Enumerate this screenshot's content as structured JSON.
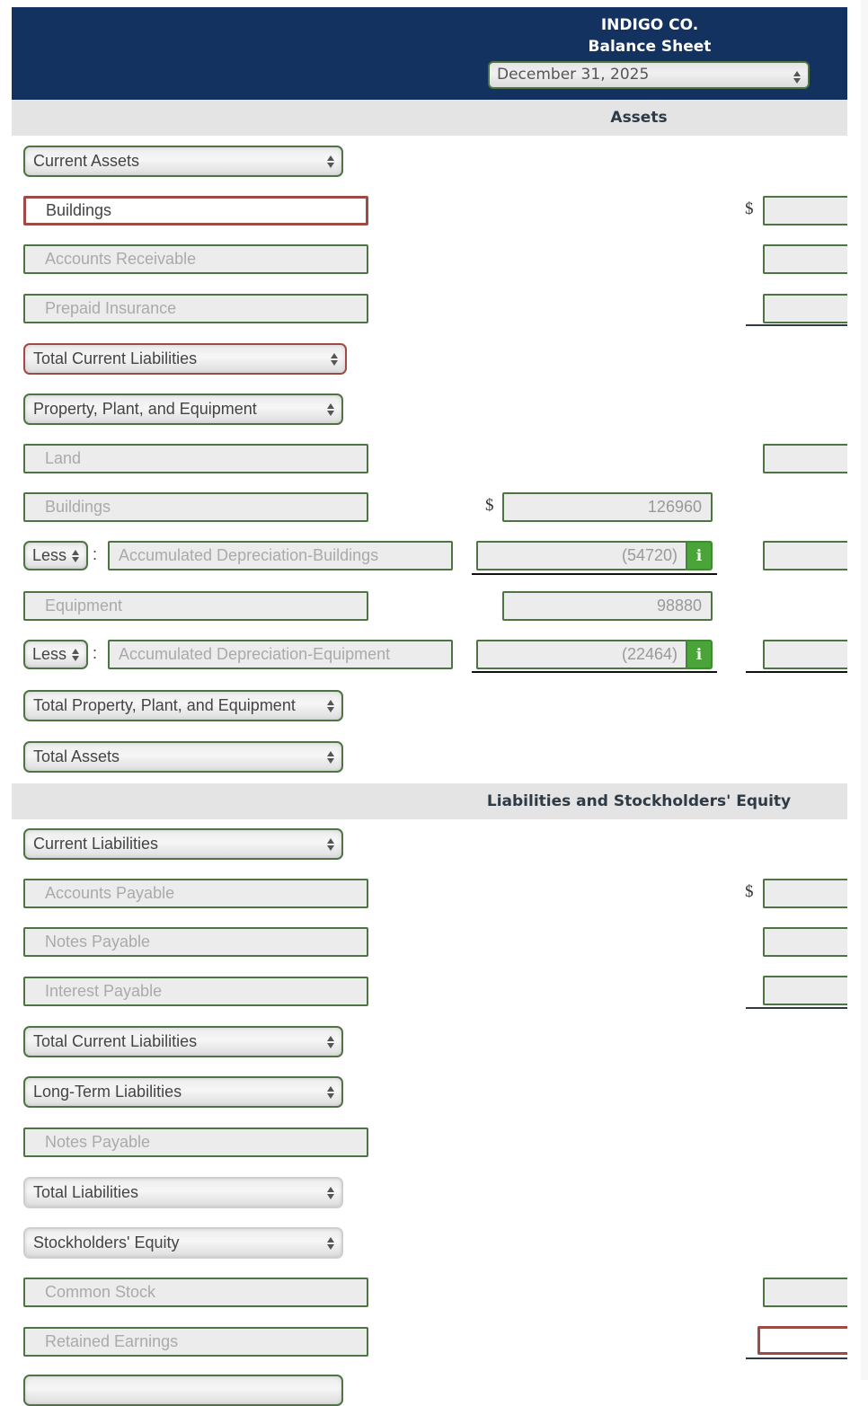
{
  "header": {
    "company": "INDIGO CO.",
    "statement": "Balance Sheet",
    "date_select": "December 31, 2025"
  },
  "sections": {
    "assets": "Assets",
    "liabilities_equity": "Liabilities and Stockholders' Equity"
  },
  "currency_symbol": "$",
  "rows": {
    "current_assets_select": "Current Assets",
    "ca_1": "Buildings",
    "ca_2": "Accounts Receivable",
    "ca_3": "Prepaid Insurance",
    "total_ca_select": "Total Current Liabilities",
    "ppe_select": "Property, Plant, and Equipment",
    "land": "Land",
    "buildings": "Buildings",
    "less_1": "Less",
    "accum_dep_buildings": "Accumulated Depreciation-Buildings",
    "equipment": "Equipment",
    "less_2": "Less",
    "accum_dep_equipment": "Accumulated Depreciation-Equipment",
    "total_ppe_select": "Total Property, Plant, and Equipment",
    "total_assets_select": "Total Assets",
    "current_liabilities_select": "Current Liabilities",
    "accounts_payable": "Accounts Payable",
    "notes_payable_cl": "Notes Payable",
    "interest_payable": "Interest Payable",
    "total_cl_select": "Total Current Liabilities",
    "ltl_select": "Long-Term Liabilities",
    "notes_payable_ltl": "Notes Payable",
    "total_liabilities_select": "Total Liabilities",
    "se_select": "Stockholders' Equity",
    "common_stock": "Common Stock",
    "retained_earnings": "Retained Earnings"
  },
  "amounts": {
    "buildings": "126960",
    "accum_dep_buildings": "(54720)",
    "equipment": "98880",
    "accum_dep_equipment": "(22464)"
  },
  "info_icon_glyph": "i",
  "colors": {
    "header_bg": "#143260",
    "correct_border": "#4c7541",
    "incorrect_border": "#a04a45",
    "info_button": "#4aa43a"
  }
}
